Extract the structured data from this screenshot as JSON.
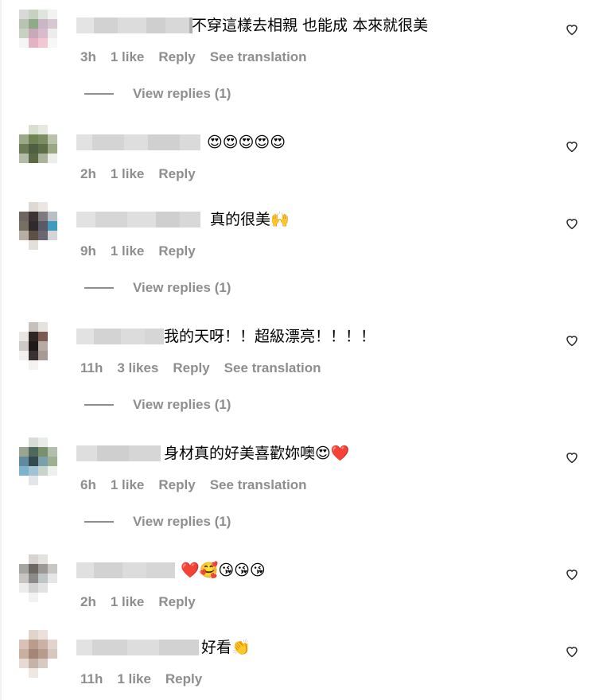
{
  "comments": [
    {
      "text": "不穿這樣去相親 也能成 本來就很美",
      "time": "3h",
      "likes": "1 like",
      "reply": "Reply",
      "translate": "See translation",
      "view_replies": "View replies (1)"
    },
    {
      "text": "😍😍😍😍😍",
      "time": "2h",
      "likes": "1 like",
      "reply": "Reply"
    },
    {
      "text": "真的很美🙌",
      "time": "9h",
      "likes": "1 like",
      "reply": "Reply",
      "view_replies": "View replies (1)"
    },
    {
      "text": "我的天呀！！超級漂亮！！！！",
      "time": "11h",
      "likes": "3 likes",
      "reply": "Reply",
      "translate": "See translation",
      "view_replies": "View replies (1)"
    },
    {
      "text": "身材真的好美喜歡妳噢😍❤️",
      "time": "6h",
      "likes": "1 like",
      "reply": "Reply",
      "translate": "See translation",
      "view_replies": "View replies (1)"
    },
    {
      "text": "❤️🥰😘😘😘",
      "time": "2h",
      "likes": "1 like",
      "reply": "Reply"
    },
    {
      "text": "好看👏",
      "time": "11h",
      "likes": "1 like",
      "reply": "Reply"
    }
  ],
  "icons": {
    "like": "heart-outline-icon"
  },
  "colors": {
    "meta": "#8e8e8e",
    "text": "#000000",
    "background": "#ffffff"
  }
}
